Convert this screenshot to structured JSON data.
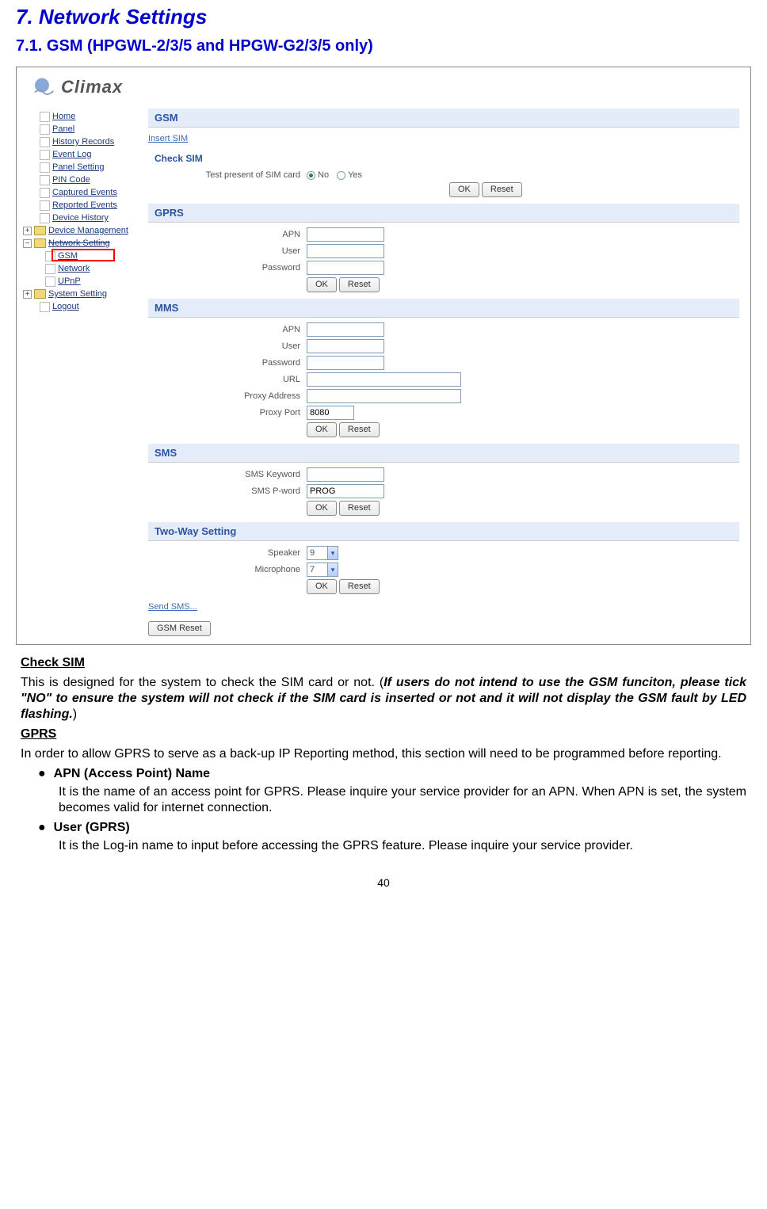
{
  "title": "7.  Network Settings",
  "subtitle": "7.1. GSM (HPGWL-2/3/5 and HPGW-G2/3/5 only)",
  "logo_text": "Climax",
  "nav": {
    "items": [
      "Home",
      "Panel",
      "History Records",
      "Event Log",
      "Panel Setting",
      "PIN Code",
      "Captured Events",
      "Reported Events",
      "Device History"
    ],
    "device_mgmt": "Device Management",
    "net_setting": "Network Setting",
    "gsm": "GSM",
    "network": "Network",
    "upnp": "UPnP",
    "sys_setting": "System Setting",
    "logout": "Logout"
  },
  "gsm": {
    "header": "GSM",
    "insert_sim": "Insert SIM",
    "check_sim": "Check SIM",
    "test_label": "Test present of SIM card",
    "no": "No",
    "yes": "Yes",
    "ok": "OK",
    "reset": "Reset"
  },
  "gprs": {
    "header": "GPRS",
    "apn_label": "APN",
    "user_label": "User",
    "pwd_label": "Password",
    "ok": "OK",
    "reset": "Reset"
  },
  "mms": {
    "header": "MMS",
    "apn_label": "APN",
    "user_label": "User",
    "pwd_label": "Password",
    "url_label": "URL",
    "proxy_addr_label": "Proxy Address",
    "proxy_port_label": "Proxy Port",
    "proxy_port_value": "8080",
    "ok": "OK",
    "reset": "Reset"
  },
  "sms": {
    "header": "SMS",
    "keyword_label": "SMS Keyword",
    "pword_label": "SMS P-word",
    "pword_value": "PROG",
    "ok": "OK",
    "reset": "Reset"
  },
  "twoway": {
    "header": "Two-Way Setting",
    "speaker_label": "Speaker",
    "speaker_value": "9",
    "mic_label": "Microphone",
    "mic_value": "7",
    "ok": "OK",
    "reset": "Reset"
  },
  "footer_links": {
    "send_sms": "Send SMS...",
    "gsm_reset": "GSM Reset"
  },
  "doc": {
    "check_sim_h": "Check SIM",
    "check_sim_p1": "This is designed for the system to check the SIM card or not. (",
    "check_sim_emph": "If users do not intend to use the GSM funciton, please tick \"NO\" to ensure the system will not check if the SIM card is inserted or not and it will not display the GSM fault by LED flashing.",
    "check_sim_p2": ")",
    "gprs_h": "GPRS",
    "gprs_p": "In order to allow GPRS to serve as a back-up IP Reporting method, this section will need to be programmed before reporting.",
    "apn_h": "APN (Access Point) Name",
    "apn_p": "It is the name of an access point for GPRS. Please inquire your service provider for an APN. When APN is set, the system becomes valid for internet connection.",
    "user_h": "User (GPRS)",
    "user_p": "It is the Log-in name to input before accessing the GPRS feature. Please inquire your service provider."
  },
  "page_number": "40"
}
